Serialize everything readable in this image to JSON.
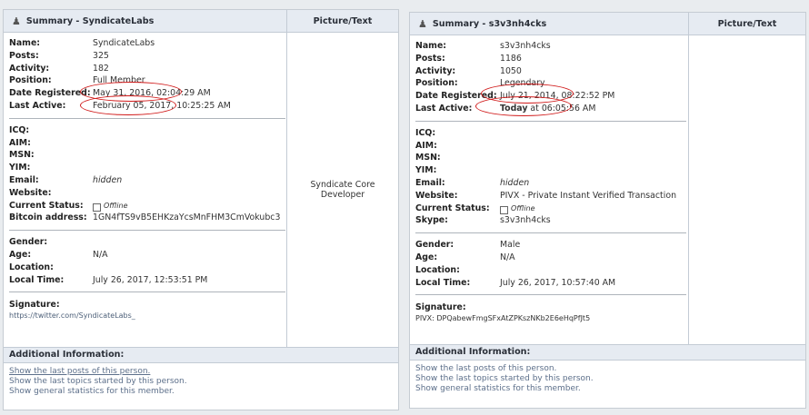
{
  "left": {
    "title": "Summary - SyndicateLabs",
    "picture_header": "Picture/Text",
    "picture_text": "Syndicate Core Developer",
    "name_label": "Name:",
    "name": "SyndicateLabs",
    "posts_label": "Posts:",
    "posts": "325",
    "activity_label": "Activity:",
    "activity": "182",
    "position_label": "Position:",
    "position": "Full Member",
    "registered_label": "Date Registered:",
    "registered": "May 31, 2016, 02:04:29 AM",
    "lastactive_label": "Last Active:",
    "lastactive": "February 05, 2017, 10:25:25 AM",
    "icq_label": "ICQ:",
    "aim_label": "AIM:",
    "msn_label": "MSN:",
    "yim_label": "YIM:",
    "email_label": "Email:",
    "email": "hidden",
    "website_label": "Website:",
    "status_label": "Current Status:",
    "status": "Offline",
    "bitcoin_label": "Bitcoin address:",
    "bitcoin": "1GN4fTS9vB5EHKzaYcsMnFHM3CmVokubc3",
    "gender_label": "Gender:",
    "age_label": "Age:",
    "age": "N/A",
    "location_label": "Location:",
    "localtime_label": "Local Time:",
    "localtime": "July 26, 2017, 12:53:51 PM",
    "signature_label": "Signature:",
    "signature": "https://twitter.com/SyndicateLabs_",
    "additional_label": "Additional Information:",
    "links": [
      "Show the last posts of this person.",
      "Show the last topics started by this person.",
      "Show general statistics for this member."
    ]
  },
  "right": {
    "title": "Summary - s3v3nh4cks",
    "picture_header": "Picture/Text",
    "name_label": "Name:",
    "name": "s3v3nh4cks",
    "posts_label": "Posts:",
    "posts": "1186",
    "activity_label": "Activity:",
    "activity": "1050",
    "position_label": "Position:",
    "position": "Legendary",
    "registered_label": "Date Registered:",
    "registered": "July 21, 2014, 08:22:52 PM",
    "lastactive_label": "Last Active:",
    "lastactive_bold": "Today",
    "lastactive_rest": " at 06:05:56 AM",
    "icq_label": "ICQ:",
    "aim_label": "AIM:",
    "msn_label": "MSN:",
    "yim_label": "YIM:",
    "email_label": "Email:",
    "email": "hidden",
    "website_label": "Website:",
    "website": "PIVX - Private Instant Verified Transaction",
    "status_label": "Current Status:",
    "status": "Offline",
    "skype_label": "Skype:",
    "skype": "s3v3nh4cks",
    "gender_label": "Gender:",
    "gender": "Male",
    "age_label": "Age:",
    "age": "N/A",
    "location_label": "Location:",
    "localtime_label": "Local Time:",
    "localtime": "July 26, 2017, 10:57:40 AM",
    "signature_label": "Signature:",
    "signature": "PIVX: DPQabewFmgSFxAtZPKszNKb2E6eHqPfJt5",
    "additional_label": "Additional Information:",
    "links": [
      "Show the last posts of this person.",
      "Show the last topics started by this person.",
      "Show general statistics for this member."
    ]
  },
  "icons": {
    "header": "user-group-icon",
    "status": "offline-checkbox-icon"
  },
  "colors": {
    "annotation": "#d01818",
    "link": "#5c6f8a",
    "header_bg": "#e6ebf2"
  }
}
